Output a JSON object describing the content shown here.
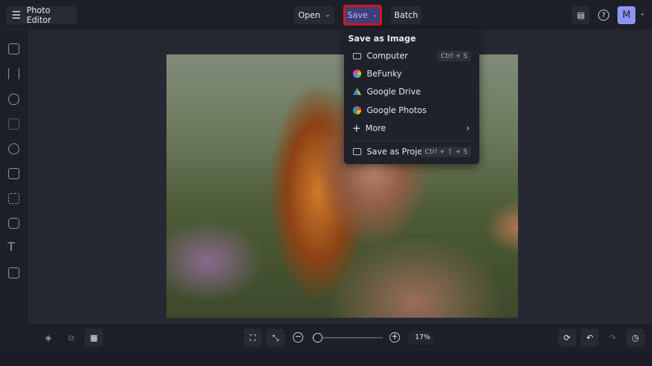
{
  "header": {
    "app_title": "Photo Editor",
    "open_label": "Open",
    "save_label": "Save",
    "batch_label": "Batch",
    "avatar_initial": "M"
  },
  "save_menu": {
    "heading": "Save as Image",
    "items": [
      {
        "label": "Computer",
        "shortcut": "Ctrl + S"
      },
      {
        "label": "BeFunky"
      },
      {
        "label": "Google Drive"
      },
      {
        "label": "Google Photos"
      },
      {
        "label": "More"
      },
      {
        "label": "Save as Project",
        "shortcut": "Ctrl + ⇧ + S"
      }
    ]
  },
  "zoom": {
    "value": "17%",
    "level": 0.03
  },
  "colors": {
    "accent": "#3e3f7a",
    "highlight": "#e0141b"
  }
}
